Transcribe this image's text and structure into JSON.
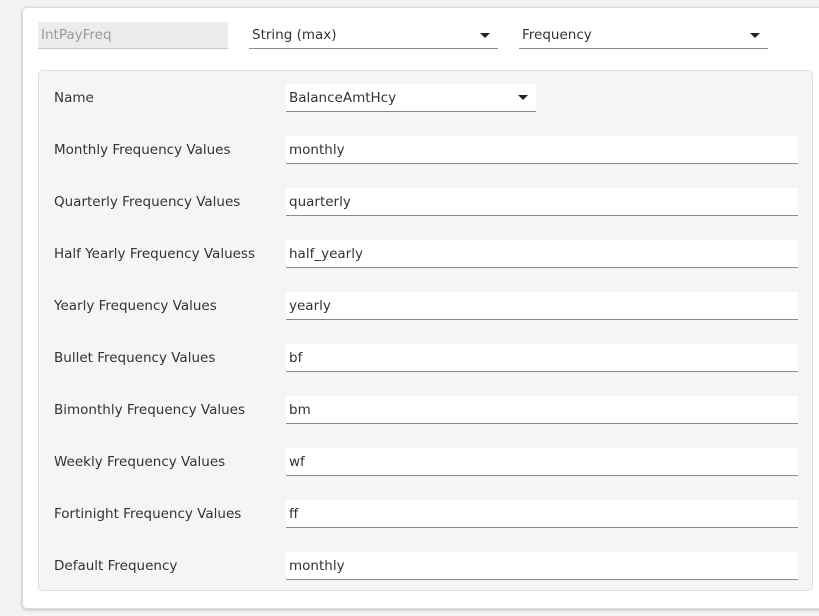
{
  "header": {
    "field_name": "IntPayFreq",
    "data_type": "String (max)",
    "category": "Frequency"
  },
  "form": {
    "name_label": "Name",
    "name_value": "BalanceAmtHcy",
    "rows": [
      {
        "label": "Monthly Frequency Values",
        "value": "monthly"
      },
      {
        "label": "Quarterly Frequency Values",
        "value": "quarterly"
      },
      {
        "label": "Half Yearly Frequency Valuess",
        "value": "half_yearly"
      },
      {
        "label": "Yearly Frequency Values",
        "value": "yearly"
      },
      {
        "label": "Bullet Frequency Values",
        "value": "bf"
      },
      {
        "label": "Bimonthly Frequency Values",
        "value": "bm"
      },
      {
        "label": "Weekly Frequency Values",
        "value": "wf"
      },
      {
        "label": "Fortinight Frequency Values",
        "value": "ff"
      },
      {
        "label": "Default Frequency",
        "value": "monthly"
      }
    ]
  },
  "icons": {
    "dropdown": "caret-down-icon"
  }
}
